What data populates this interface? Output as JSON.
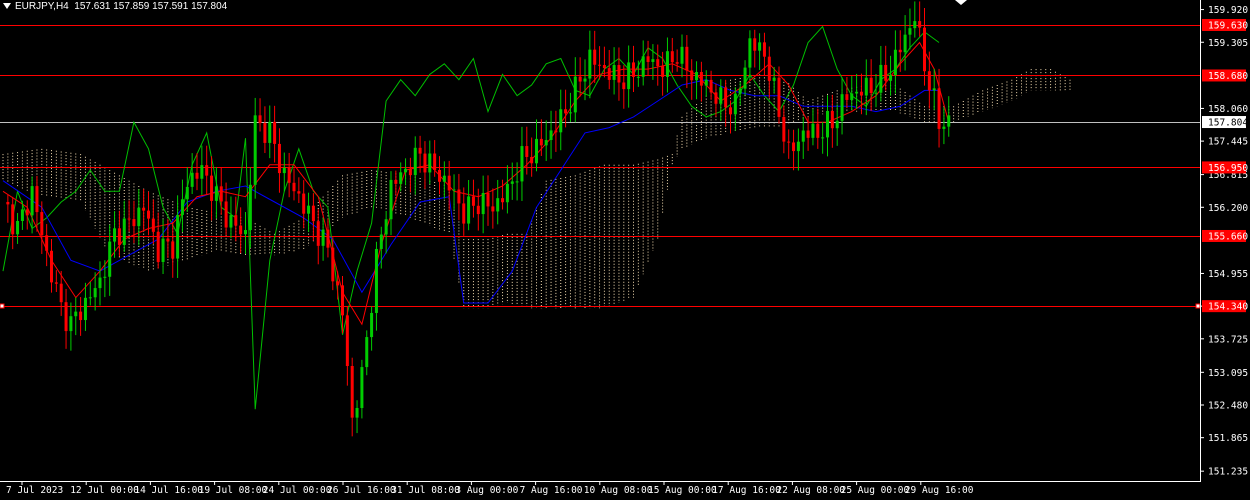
{
  "header": {
    "symbol": "EURJPY,H4",
    "ohlc": "157.631 157.859 157.591 157.804"
  },
  "colors": {
    "background": "#000000",
    "bull_candle": "#00cc00",
    "bear_candle": "#ff0000",
    "tenkan": "#ff0000",
    "kijun": "#0000ff",
    "chikou": "#00c000",
    "kumo_dots": "#f5deb3",
    "level_line": "#ff0000",
    "level_label_bg": "#ff0000",
    "price_label_bg": "#ffffff",
    "axis_text": "#ffffff"
  },
  "chart_data": {
    "type": "candlestick",
    "indicator": "ichimoku",
    "ylim": [
      151.05,
      160.1
    ],
    "y_ticks": [
      "159.920",
      "159.305",
      "158.060",
      "157.445",
      "156.815",
      "156.200",
      "154.955",
      "154.340",
      "153.725",
      "153.095",
      "152.480",
      "151.865",
      "151.235"
    ],
    "x_ticks": [
      "7 Jul 2023",
      "12 Jul 00:00",
      "14 Jul 16:00",
      "19 Jul 08:00",
      "24 Jul 00:00",
      "26 Jul 16:00",
      "31 Jul 08:00",
      "3 Aug 00:00",
      "7 Aug 16:00",
      "10 Aug 08:00",
      "15 Aug 00:00",
      "17 Aug 16:00",
      "22 Aug 08:00",
      "25 Aug 00:00",
      "29 Aug 16:00"
    ],
    "levels": [
      {
        "value": 159.63,
        "label": "159.630"
      },
      {
        "value": 158.68,
        "label": "158.680"
      },
      {
        "value": 156.95,
        "label": "156.950"
      },
      {
        "value": 155.66,
        "label": "155.660"
      },
      {
        "value": 154.34,
        "label": "154.340"
      }
    ],
    "current_price": {
      "value": 157.804,
      "label": "157.804"
    },
    "close_path": [
      [
        0,
        156.3
      ],
      [
        3,
        155.8
      ],
      [
        6,
        156.5
      ],
      [
        9,
        155.3
      ],
      [
        12,
        154.3
      ],
      [
        14,
        154.0
      ],
      [
        17,
        154.4
      ],
      [
        20,
        154.8
      ],
      [
        23,
        155.7
      ],
      [
        26,
        155.9
      ],
      [
        29,
        156.2
      ],
      [
        32,
        155.4
      ],
      [
        35,
        155.5
      ],
      [
        38,
        156.7
      ],
      [
        41,
        156.9
      ],
      [
        44,
        156.4
      ],
      [
        47,
        155.9
      ],
      [
        50,
        155.7
      ],
      [
        52,
        157.8
      ],
      [
        55,
        157.6
      ],
      [
        58,
        156.8
      ],
      [
        61,
        156.4
      ],
      [
        64,
        155.9
      ],
      [
        67,
        155.4
      ],
      [
        70,
        154.2
      ],
      [
        72,
        152.2
      ],
      [
        74,
        153.0
      ],
      [
        77,
        155.2
      ],
      [
        80,
        156.6
      ],
      [
        83,
        156.9
      ],
      [
        86,
        157.2
      ],
      [
        89,
        156.9
      ],
      [
        92,
        156.6
      ],
      [
        95,
        156.1
      ],
      [
        98,
        156.3
      ],
      [
        101,
        156.2
      ],
      [
        104,
        156.5
      ],
      [
        107,
        157.1
      ],
      [
        110,
        157.3
      ],
      [
        113,
        157.6
      ],
      [
        116,
        158.0
      ],
      [
        118,
        158.4
      ],
      [
        121,
        159.0
      ],
      [
        124,
        158.8
      ],
      [
        127,
        158.6
      ],
      [
        130,
        158.7
      ],
      [
        133,
        159.0
      ],
      [
        136,
        158.8
      ],
      [
        139,
        159.1
      ],
      [
        142,
        158.7
      ],
      [
        145,
        158.5
      ],
      [
        148,
        158.2
      ],
      [
        151,
        158.1
      ],
      [
        154,
        159.3
      ],
      [
        157,
        159.1
      ],
      [
        160,
        158.0
      ],
      [
        162,
        157.2
      ],
      [
        165,
        157.6
      ],
      [
        168,
        157.6
      ],
      [
        171,
        157.8
      ],
      [
        174,
        158.3
      ],
      [
        177,
        158.4
      ],
      [
        180,
        158.5
      ],
      [
        183,
        158.8
      ],
      [
        186,
        159.4
      ],
      [
        188,
        159.8
      ],
      [
        190,
        158.9
      ],
      [
        193,
        157.8
      ],
      [
        195,
        157.8
      ]
    ],
    "tenkan_path": [
      [
        0,
        156.5
      ],
      [
        5,
        156.2
      ],
      [
        10,
        155.2
      ],
      [
        15,
        154.5
      ],
      [
        20,
        155.0
      ],
      [
        25,
        155.6
      ],
      [
        30,
        155.8
      ],
      [
        35,
        155.9
      ],
      [
        40,
        156.4
      ],
      [
        45,
        156.5
      ],
      [
        50,
        156.4
      ],
      [
        55,
        157.0
      ],
      [
        60,
        157.0
      ],
      [
        65,
        156.4
      ],
      [
        70,
        154.6
      ],
      [
        74,
        154.0
      ],
      [
        78,
        155.5
      ],
      [
        83,
        156.9
      ],
      [
        88,
        157.0
      ],
      [
        93,
        156.5
      ],
      [
        98,
        156.4
      ],
      [
        103,
        156.6
      ],
      [
        108,
        157.0
      ],
      [
        113,
        157.5
      ],
      [
        118,
        158.2
      ],
      [
        123,
        158.7
      ],
      [
        128,
        158.8
      ],
      [
        133,
        158.8
      ],
      [
        138,
        158.9
      ],
      [
        143,
        158.7
      ],
      [
        148,
        158.2
      ],
      [
        153,
        158.5
      ],
      [
        158,
        158.9
      ],
      [
        162,
        158.5
      ],
      [
        166,
        157.8
      ],
      [
        170,
        157.8
      ],
      [
        175,
        158.0
      ],
      [
        180,
        158.3
      ],
      [
        185,
        158.9
      ],
      [
        189,
        159.3
      ],
      [
        192,
        158.8
      ],
      [
        195,
        157.8
      ]
    ],
    "kijun_path": [
      [
        0,
        156.7
      ],
      [
        8,
        156.2
      ],
      [
        14,
        155.2
      ],
      [
        20,
        155.0
      ],
      [
        26,
        155.3
      ],
      [
        32,
        155.6
      ],
      [
        38,
        156.3
      ],
      [
        44,
        156.5
      ],
      [
        50,
        156.6
      ],
      [
        56,
        156.3
      ],
      [
        62,
        156.0
      ],
      [
        68,
        155.6
      ],
      [
        74,
        154.6
      ],
      [
        80,
        155.5
      ],
      [
        86,
        156.3
      ],
      [
        92,
        156.4
      ],
      [
        95,
        154.4
      ],
      [
        100,
        154.4
      ],
      [
        105,
        155.0
      ],
      [
        110,
        156.2
      ],
      [
        115,
        156.9
      ],
      [
        120,
        157.6
      ],
      [
        125,
        157.7
      ],
      [
        130,
        157.9
      ],
      [
        135,
        158.2
      ],
      [
        140,
        158.5
      ],
      [
        145,
        158.6
      ],
      [
        150,
        158.4
      ],
      [
        155,
        158.3
      ],
      [
        160,
        158.3
      ],
      [
        165,
        158.1
      ],
      [
        170,
        158.1
      ],
      [
        175,
        158.1
      ],
      [
        180,
        158.0
      ],
      [
        185,
        158.1
      ],
      [
        190,
        158.4
      ],
      [
        193,
        158.4
      ]
    ],
    "chikou_path": [
      [
        0,
        155.0
      ],
      [
        3,
        156.5
      ],
      [
        6,
        155.8
      ],
      [
        9,
        156.0
      ],
      [
        12,
        156.3
      ],
      [
        15,
        156.5
      ],
      [
        18,
        156.9
      ],
      [
        21,
        156.5
      ],
      [
        24,
        156.5
      ],
      [
        27,
        157.8
      ],
      [
        30,
        157.3
      ],
      [
        33,
        156.2
      ],
      [
        36,
        155.7
      ],
      [
        39,
        157.0
      ],
      [
        42,
        157.6
      ],
      [
        45,
        156.2
      ],
      [
        48,
        156.0
      ],
      [
        50,
        157.5
      ],
      [
        52,
        152.4
      ],
      [
        55,
        155.2
      ],
      [
        58,
        156.5
      ],
      [
        61,
        157.3
      ],
      [
        64,
        156.5
      ],
      [
        67,
        156.2
      ],
      [
        70,
        153.8
      ],
      [
        73,
        155.0
      ],
      [
        76,
        155.9
      ],
      [
        79,
        158.2
      ],
      [
        82,
        158.6
      ],
      [
        85,
        158.3
      ],
      [
        88,
        158.7
      ],
      [
        91,
        158.9
      ],
      [
        94,
        158.6
      ],
      [
        97,
        159.0
      ],
      [
        100,
        158.0
      ],
      [
        103,
        158.7
      ],
      [
        106,
        158.3
      ],
      [
        109,
        158.5
      ],
      [
        112,
        158.9
      ],
      [
        115,
        159.0
      ],
      [
        118,
        158.4
      ],
      [
        121,
        158.3
      ],
      [
        124,
        158.8
      ],
      [
        127,
        159.0
      ],
      [
        130,
        158.7
      ],
      [
        133,
        159.2
      ],
      [
        136,
        159.0
      ],
      [
        139,
        158.5
      ],
      [
        142,
        158.1
      ],
      [
        145,
        157.9
      ],
      [
        148,
        158.0
      ],
      [
        151,
        158.2
      ],
      [
        154,
        158.7
      ],
      [
        157,
        158.3
      ],
      [
        160,
        158.0
      ],
      [
        163,
        158.5
      ],
      [
        166,
        159.3
      ],
      [
        169,
        159.6
      ],
      [
        172,
        158.8
      ],
      [
        175,
        158.3
      ],
      [
        178,
        158.1
      ],
      [
        181,
        158.6
      ],
      [
        184,
        158.8
      ],
      [
        187,
        159.2
      ],
      [
        190,
        159.5
      ],
      [
        193,
        159.3
      ]
    ],
    "kumo": [
      [
        0,
        157.2,
        156.7
      ],
      [
        8,
        157.3,
        156.4
      ],
      [
        16,
        157.2,
        156.3
      ],
      [
        22,
        156.9,
        155.3
      ],
      [
        30,
        156.5,
        155.0
      ],
      [
        38,
        156.2,
        155.2
      ],
      [
        44,
        156.1,
        155.4
      ],
      [
        50,
        156.0,
        155.3
      ],
      [
        56,
        155.7,
        155.3
      ],
      [
        62,
        156.0,
        155.4
      ],
      [
        70,
        156.8,
        156.0
      ],
      [
        76,
        156.9,
        156.2
      ],
      [
        84,
        156.8,
        156.0
      ],
      [
        92,
        156.6,
        155.7
      ],
      [
        95,
        155.6,
        154.3
      ],
      [
        100,
        155.6,
        154.3
      ],
      [
        104,
        155.7,
        154.4
      ],
      [
        108,
        155.7,
        154.3
      ],
      [
        112,
        156.7,
        154.3
      ],
      [
        118,
        156.8,
        154.3
      ],
      [
        124,
        157.0,
        154.3
      ],
      [
        130,
        157.0,
        154.5
      ],
      [
        135,
        157.1,
        155.6
      ],
      [
        138,
        157.2,
        157.0
      ],
      [
        140,
        157.9,
        157.3
      ],
      [
        145,
        158.3,
        157.5
      ],
      [
        150,
        158.6,
        157.6
      ],
      [
        156,
        158.7,
        157.7
      ],
      [
        160,
        158.7,
        157.7
      ],
      [
        166,
        158.2,
        157.9
      ],
      [
        172,
        158.4,
        158.0
      ],
      [
        178,
        158.5,
        158.0
      ],
      [
        184,
        158.5,
        158.0
      ],
      [
        190,
        158.1,
        157.8
      ],
      [
        196,
        158.1,
        157.8
      ],
      [
        202,
        158.4,
        158.0
      ],
      [
        208,
        158.6,
        158.2
      ],
      [
        212,
        158.8,
        158.4
      ],
      [
        216,
        158.8,
        158.4
      ],
      [
        220,
        158.6,
        158.4
      ]
    ]
  }
}
